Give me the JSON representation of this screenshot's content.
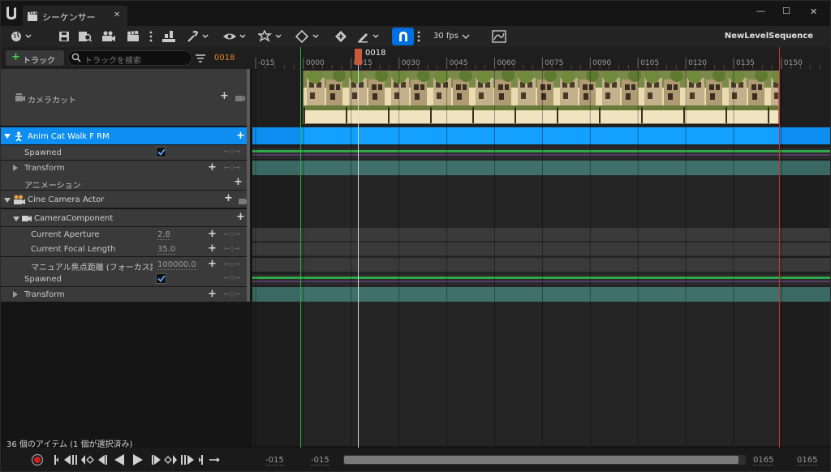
{
  "titlebar": {
    "tab_title": "シーケンサー",
    "close": "✕",
    "win_min": "—",
    "win_max": "☐",
    "win_close": "✕"
  },
  "toolbar": {
    "fps": "30 fps",
    "sequence_name": "NewLevelSequence"
  },
  "outliner": {
    "add_track": "トラック",
    "search_placeholder": "トラックを検索",
    "current_frame": "0018",
    "status": "36 個のアイテム (1 個が選択済み)",
    "tracks": {
      "camera_cut": "カメラカット",
      "anim_cat": "Anim Cat Walk F RM",
      "spawned1": "Spawned",
      "transform1": "Transform",
      "animation": "アニメーション",
      "cine_camera": "Cine Camera Actor",
      "camera_component": "CameraComponent",
      "aperture": "Current Aperture",
      "aperture_value": "2.8",
      "focal_length": "Current Focal Length",
      "focal_value": "35.0",
      "focus_distance": "マニュアル焦点距離 (フォーカス設定)",
      "focus_value": "100000.0",
      "spawned2": "Spawned",
      "transform2": "Transform"
    }
  },
  "timeline": {
    "playhead_label": "0018",
    "ticks": [
      "-015",
      "0000",
      "0015",
      "0030",
      "0045",
      "0060",
      "0075",
      "0090",
      "0105",
      "0120",
      "0135",
      "0150"
    ],
    "bottom": {
      "view_start": "-015",
      "work_start": "-015",
      "work_end": "0165",
      "view_end": "0165"
    }
  },
  "colors": {
    "accent": "#0070e0",
    "selection": "#0d8ef0",
    "playhead": "#c85a3c",
    "start_marker": "#2faa3a",
    "end_marker": "#c83232",
    "key_track": "#3a6862",
    "mark_on_thumb": "#e08020"
  }
}
